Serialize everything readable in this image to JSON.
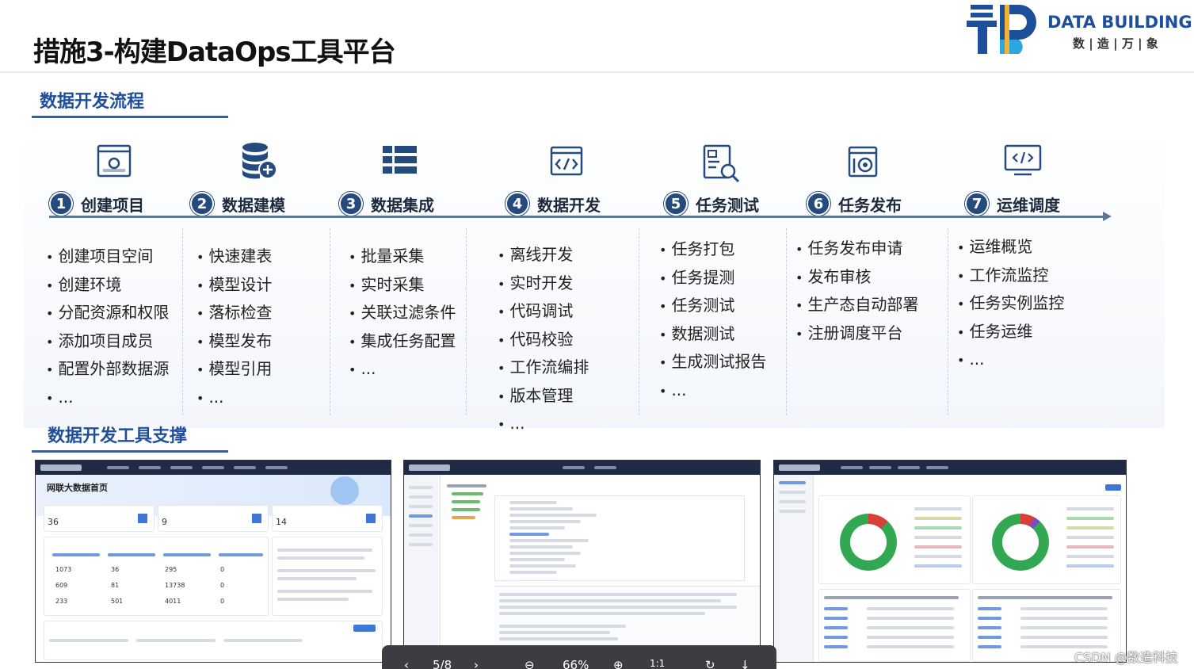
{
  "header": {
    "title": "措施3-构建DataOps工具平台",
    "logo_text": "DATA BUILDING",
    "logo_sub": "数 | 造 | 万 | 象",
    "brand_color": "#1d4f9b"
  },
  "process": {
    "section_title": "数据开发流程",
    "steps": [
      {
        "num": "1",
        "name": "创建项目",
        "icon": "browser-window-icon",
        "items": [
          "创建项目空间",
          "创建环境",
          "分配资源和权限",
          "添加项目成员",
          "配置外部数据源",
          "..."
        ]
      },
      {
        "num": "2",
        "name": "数据建模",
        "icon": "database-add-icon",
        "items": [
          "快速建表",
          "模型设计",
          "落标检查",
          "模型发布",
          "模型引用",
          "..."
        ]
      },
      {
        "num": "3",
        "name": "数据集成",
        "icon": "table-grid-icon",
        "items": [
          "批量采集",
          "实时采集",
          "关联过滤条件",
          "集成任务配置",
          "..."
        ]
      },
      {
        "num": "4",
        "name": "数据开发",
        "icon": "code-window-icon",
        "items": [
          "离线开发",
          "实时开发",
          "代码调试",
          "代码校验",
          "工作流编排",
          "版本管理",
          "..."
        ]
      },
      {
        "num": "5",
        "name": "任务测试",
        "icon": "document-search-icon",
        "items": [
          "任务打包",
          "任务提测",
          "任务测试",
          "数据测试",
          "生成测试报告",
          "..."
        ]
      },
      {
        "num": "6",
        "name": "任务发布",
        "icon": "publish-icon",
        "items": [
          "任务发布申请",
          "发布审核",
          "生产态自动部署",
          "注册调度平台"
        ]
      },
      {
        "num": "7",
        "name": "运维调度",
        "icon": "monitor-code-icon",
        "items": [
          "运维概览",
          "工作流监控",
          "任务实例监控",
          "任务运维",
          "..."
        ]
      }
    ]
  },
  "tools": {
    "section_title": "数据开发工具支撑",
    "shot1": {
      "page_title": "网联大数据首页",
      "stats": [
        "36",
        "9",
        "14"
      ],
      "metrics": [
        "1073",
        "36",
        "295",
        "0",
        "609",
        "81",
        "13738",
        "0",
        "233",
        "501",
        "4011",
        "0"
      ]
    }
  },
  "viewer": {
    "page": "5/8",
    "zoom": "66%",
    "fit": "1:1"
  },
  "watermark": "CSDN @数造科技"
}
